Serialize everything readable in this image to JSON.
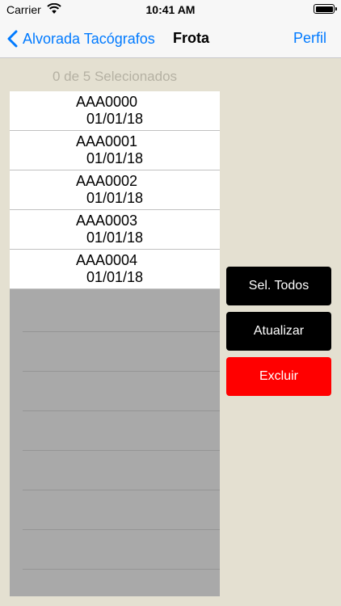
{
  "status_bar": {
    "carrier": "Carrier",
    "time": "10:41 AM"
  },
  "nav": {
    "back_label": "Alvorada Tacógrafos",
    "title": "Frota",
    "right_label": "Perfil"
  },
  "selection": {
    "count_text": "0 de 5 Selecionados"
  },
  "vehicles": [
    {
      "plate": "AAA0000",
      "date": "01/01/18"
    },
    {
      "plate": "AAA0001",
      "date": "01/01/18"
    },
    {
      "plate": "AAA0002",
      "date": "01/01/18"
    },
    {
      "plate": "AAA0003",
      "date": "01/01/18"
    },
    {
      "plate": "AAA0004",
      "date": "01/01/18"
    }
  ],
  "actions": {
    "select_all": "Sel. Todos",
    "refresh": "Atualizar",
    "delete": "Excluir"
  },
  "colors": {
    "accent": "#007aff",
    "background": "#e4e0d1",
    "danger": "#ff0000"
  }
}
